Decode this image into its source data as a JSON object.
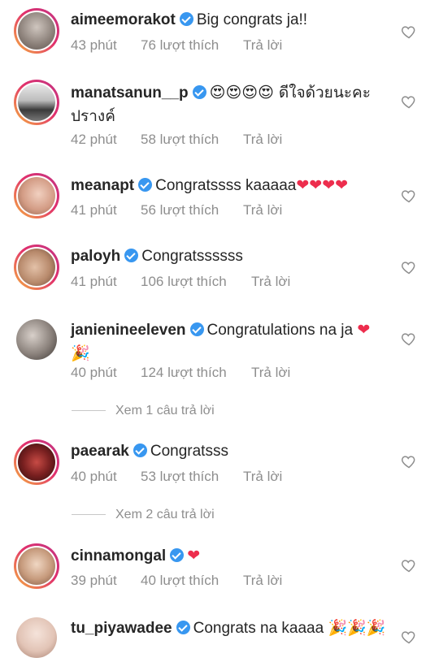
{
  "comments": [
    {
      "username": "aimeemorakot",
      "text": "Big congrats ja!!",
      "time": "43 phút",
      "likes": "76 lượt thích",
      "reply": "Trả lời",
      "avatar_color": "#9a8f88"
    },
    {
      "username": "manatsanun__p",
      "text": "😍😍😍😍 ดีใจด้วยนะคะปรางค์",
      "time": "42 phút",
      "likes": "58 lượt thích",
      "reply": "Trả lời",
      "avatar_color": "#6f6f6f"
    },
    {
      "username": "meanapt",
      "text": "Congratssss kaaaaa",
      "hearts": "❤❤❤❤",
      "time": "41 phút",
      "likes": "56 lượt thích",
      "reply": "Trả lời",
      "avatar_color": "#d9a08a"
    },
    {
      "username": "paloyh",
      "text": "Congratssssss",
      "time": "41 phút",
      "likes": "106 lượt thích",
      "reply": "Trả lời",
      "avatar_color": "#c29b80"
    },
    {
      "username": "janienineeleven",
      "text": "Congratulations na ja",
      "hearts": "❤",
      "party": "🎉",
      "time": "40 phút",
      "likes": "124 lượt thích",
      "reply": "Trả lời",
      "view_replies": "Xem 1 câu trả lời",
      "avatar_color": "#8a8079"
    },
    {
      "username": "paearak",
      "text": "Congratsss",
      "time": "40 phút",
      "likes": "53 lượt thích",
      "reply": "Trả lời",
      "view_replies": "Xem 2 câu trả lời",
      "avatar_color": "#7a2b2b"
    },
    {
      "username": "cinnamongal",
      "hearts": "❤",
      "time": "39 phút",
      "likes": "40 lượt thích",
      "reply": "Trả lời",
      "avatar_color": "#d7b49b"
    },
    {
      "username": "tu_piyawadee",
      "text": "Congrats na kaaaa",
      "party": "🎉🎉🎉",
      "avatar_color": "#e6cfc4"
    }
  ],
  "colors": {
    "verified": "#3897f0",
    "meta": "#8e8e8e",
    "heart": "#ed2d4d"
  }
}
